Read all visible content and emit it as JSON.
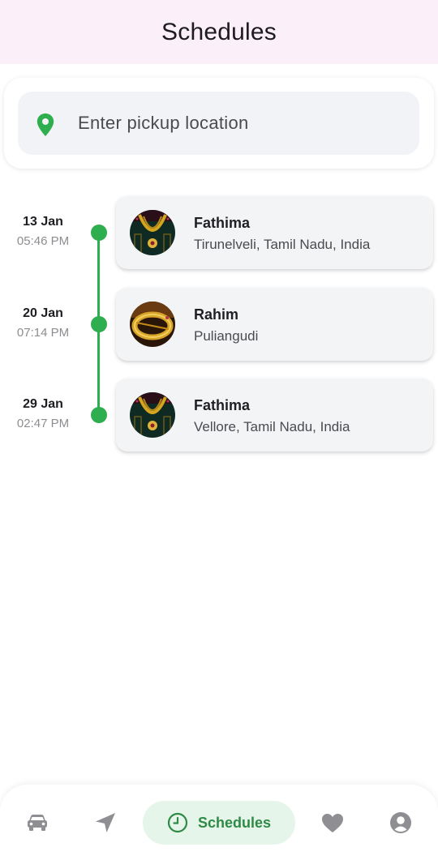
{
  "header": {
    "title": "Schedules"
  },
  "search": {
    "placeholder": "Enter pickup location",
    "icon": "location-pin-icon"
  },
  "colors": {
    "accent": "#2fae4f",
    "header_bg": "#fbf0fa",
    "nav_active_bg": "#e6f5ea"
  },
  "schedules": [
    {
      "date": "13 Jan",
      "time": "05:46 PM",
      "name": "Fathima",
      "location": "Tirunelveli, Tamil Nadu, India",
      "image": "gold-necklace-thumbnail"
    },
    {
      "date": "20 Jan",
      "time": "07:14 PM",
      "name": "Rahim",
      "location": "Puliangudi",
      "image": "gold-bangle-thumbnail"
    },
    {
      "date": "29 Jan",
      "time": "02:47 PM",
      "name": "Fathima",
      "location": "Vellore, Tamil Nadu, India",
      "image": "gold-necklace-thumbnail"
    }
  ],
  "nav": {
    "items": [
      {
        "icon": "car-icon"
      },
      {
        "icon": "navigation-arrow-icon"
      },
      {
        "icon": "clock-icon",
        "label": "Schedules",
        "active": true
      },
      {
        "icon": "heart-icon"
      },
      {
        "icon": "profile-icon"
      }
    ]
  }
}
